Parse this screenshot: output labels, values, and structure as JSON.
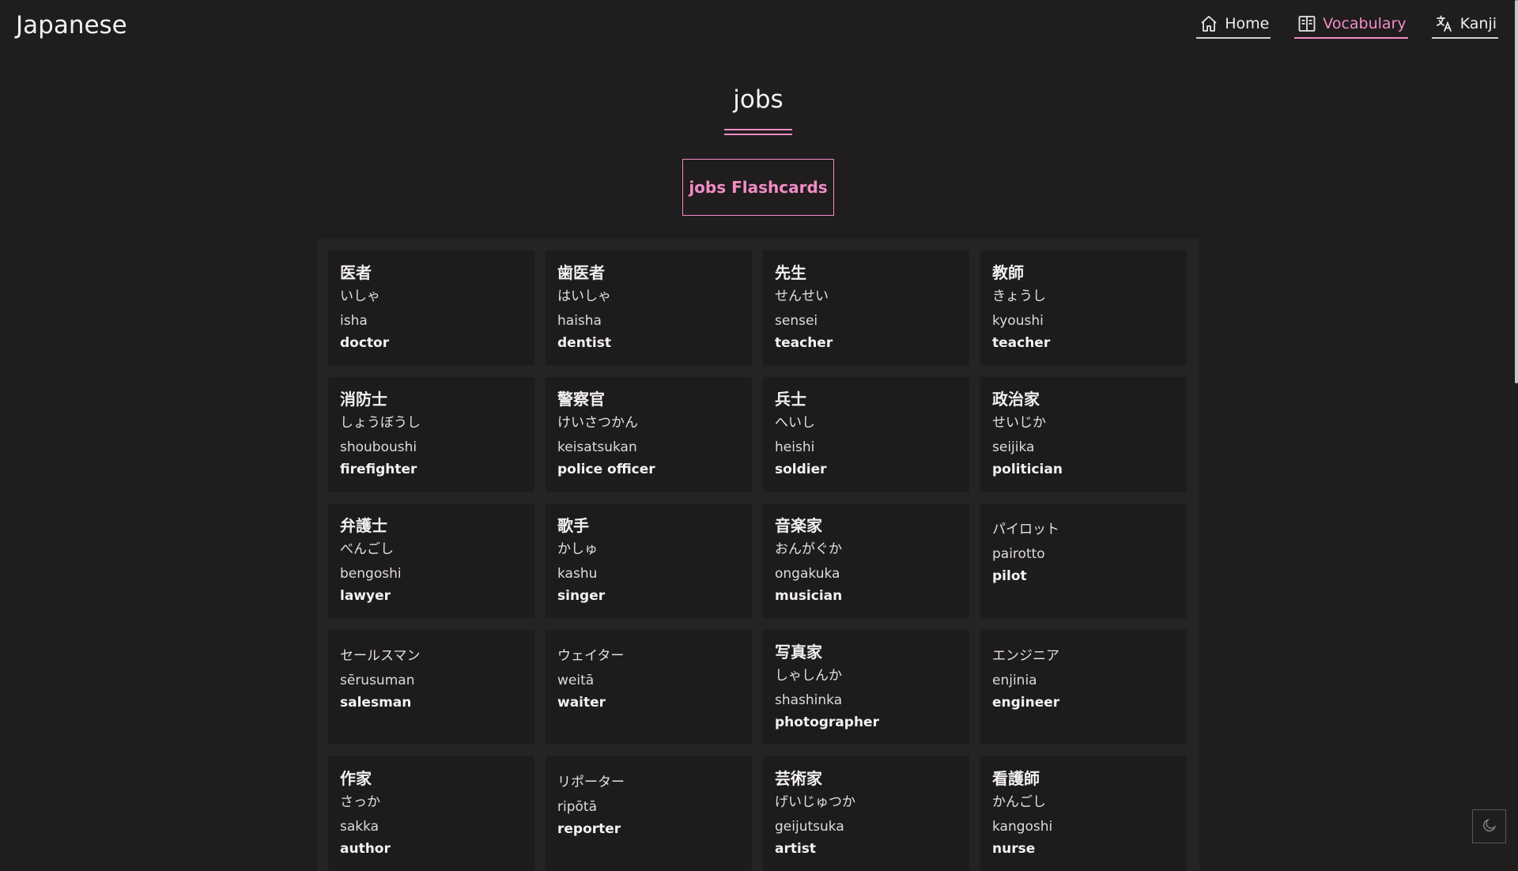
{
  "brand": "Japanese",
  "nav": {
    "home": "Home",
    "vocabulary": "Vocabulary",
    "kanji": "Kanji"
  },
  "page": {
    "title": "jobs",
    "flashcards_button": "jobs Flashcards"
  },
  "colors": {
    "accent": "#f28cc6",
    "background": "#1f1d1e",
    "panel": "#252324",
    "card": "#1d1b1c"
  },
  "cards": [
    {
      "kanji": "医者",
      "kana": "いしゃ",
      "romaji": "isha",
      "english": "doctor"
    },
    {
      "kanji": "歯医者",
      "kana": "はいしゃ",
      "romaji": "haisha",
      "english": "dentist"
    },
    {
      "kanji": "先生",
      "kana": "せんせい",
      "romaji": "sensei",
      "english": "teacher"
    },
    {
      "kanji": "教師",
      "kana": "きょうし",
      "romaji": "kyoushi",
      "english": "teacher"
    },
    {
      "kanji": "消防士",
      "kana": "しょうぼうし",
      "romaji": "shouboushi",
      "english": "firefighter"
    },
    {
      "kanji": "警察官",
      "kana": "けいさつかん",
      "romaji": "keisatsukan",
      "english": "police officer"
    },
    {
      "kanji": "兵士",
      "kana": "へいし",
      "romaji": "heishi",
      "english": "soldier"
    },
    {
      "kanji": "政治家",
      "kana": "せいじか",
      "romaji": "seijika",
      "english": "politician"
    },
    {
      "kanji": "弁護士",
      "kana": "べんごし",
      "romaji": "bengoshi",
      "english": "lawyer"
    },
    {
      "kanji": "歌手",
      "kana": "かしゅ",
      "romaji": "kashu",
      "english": "singer"
    },
    {
      "kanji": "音楽家",
      "kana": "おんがぐか",
      "romaji": "ongakuka",
      "english": "musician"
    },
    {
      "kanji": "",
      "kana": "パイロット",
      "romaji": "pairotto",
      "english": "pilot"
    },
    {
      "kanji": "",
      "kana": "セールスマン",
      "romaji": "sērusuman",
      "english": "salesman"
    },
    {
      "kanji": "",
      "kana": "ウェイター",
      "romaji": "weitā",
      "english": "waiter"
    },
    {
      "kanji": "写真家",
      "kana": "しゃしんか",
      "romaji": "shashinka",
      "english": "photographer"
    },
    {
      "kanji": "",
      "kana": "エンジニア",
      "romaji": "enjinia",
      "english": "engineer"
    },
    {
      "kanji": "作家",
      "kana": "さっか",
      "romaji": "sakka",
      "english": "author"
    },
    {
      "kanji": "",
      "kana": "リポーター",
      "romaji": "ripōtā",
      "english": "reporter"
    },
    {
      "kanji": "芸術家",
      "kana": "げいじゅつか",
      "romaji": "geijutsuka",
      "english": "artist"
    },
    {
      "kanji": "看護師",
      "kana": "かんごし",
      "romaji": "kangoshi",
      "english": "nurse"
    }
  ],
  "icons": {
    "home": "home-icon",
    "vocabulary": "book-icon",
    "kanji": "translate-icon",
    "theme": "moon-icon"
  }
}
